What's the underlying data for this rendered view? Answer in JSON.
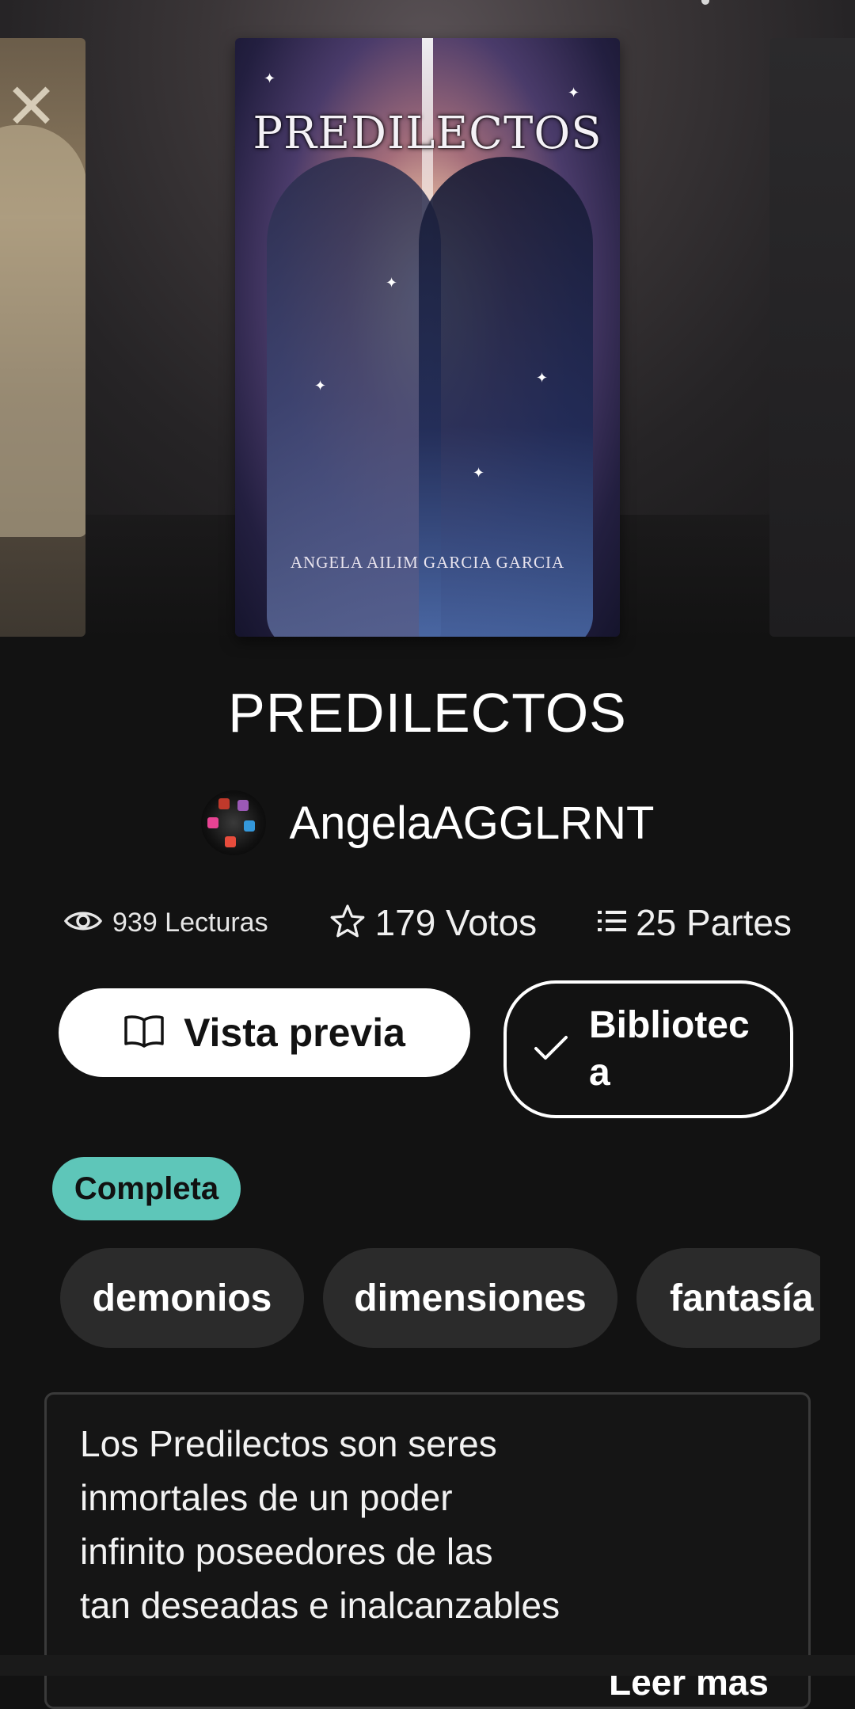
{
  "carousel": {
    "main_cover": {
      "title": "PREDILECTOS",
      "author": "ANGELA AILIM GARCIA GARCIA"
    }
  },
  "story": {
    "title": "PREDILECTOS",
    "author": "AngelaAGGLRNT"
  },
  "stats": {
    "reads": "939 Lecturas",
    "votes": "179 Votos",
    "parts": "25 Partes"
  },
  "actions": {
    "preview_label": "Vista previa",
    "library_label": "Biblioteca"
  },
  "status_badge": "Completa",
  "tags": [
    "demonios",
    "dimensiones",
    "fantasía"
  ],
  "description": {
    "text": "Los Predilectos son seres\ninmortales de un poder\ninfinito poseedores de las\ntan deseadas e inalcanzables",
    "read_more": "Leer más"
  },
  "colors": {
    "background": "#121212",
    "badge": "#5ec6b9",
    "tag_bg": "#2b2b2b"
  },
  "icons": {
    "reads": "eye-icon",
    "votes": "star-icon",
    "parts": "list-icon",
    "preview": "book-icon",
    "library": "check-icon"
  }
}
